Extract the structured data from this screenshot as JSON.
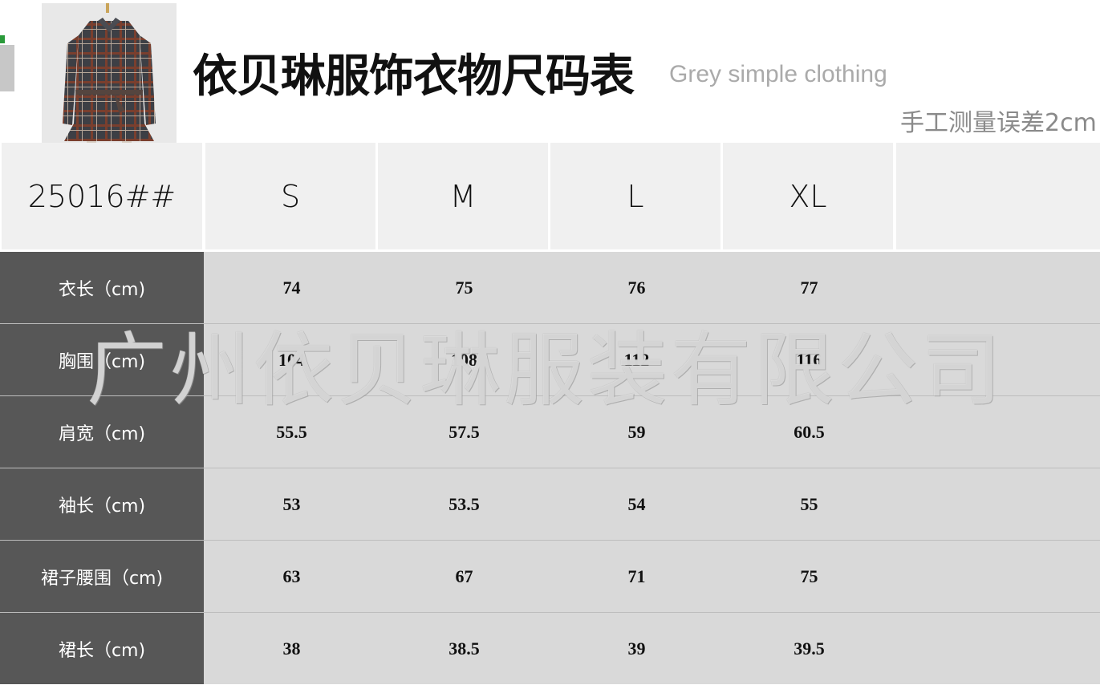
{
  "header": {
    "title": "依贝琳服饰衣物尺码表",
    "subtitle": "Grey simple clothing",
    "note": "手工测量误差2cm"
  },
  "table": {
    "corner_label": "25016##",
    "sizes": [
      "S",
      "M",
      "L",
      "XL",
      ""
    ],
    "rows": [
      {
        "label": "衣长（cm)",
        "values": [
          "74",
          "75",
          "76",
          "77"
        ]
      },
      {
        "label": "胸围（cm)",
        "values": [
          "104",
          "108",
          "112",
          "116"
        ]
      },
      {
        "label": "肩宽（cm)",
        "values": [
          "55.5",
          "57.5",
          "59",
          "60.5"
        ]
      },
      {
        "label": "袖长（cm)",
        "values": [
          "53",
          "53.5",
          "54",
          "55"
        ]
      },
      {
        "label": "裙子腰围（cm)",
        "values": [
          "63",
          "67",
          "71",
          "75"
        ]
      },
      {
        "label": "裙长（cm)",
        "values": [
          "38",
          "38.5",
          "39",
          "39.5"
        ]
      }
    ]
  },
  "watermark": "广州依贝琳服装有限公司",
  "colors": {
    "label_bg": "#575757",
    "data_bg": "#d9d9d9",
    "header_bg": "#f0f0f0"
  }
}
